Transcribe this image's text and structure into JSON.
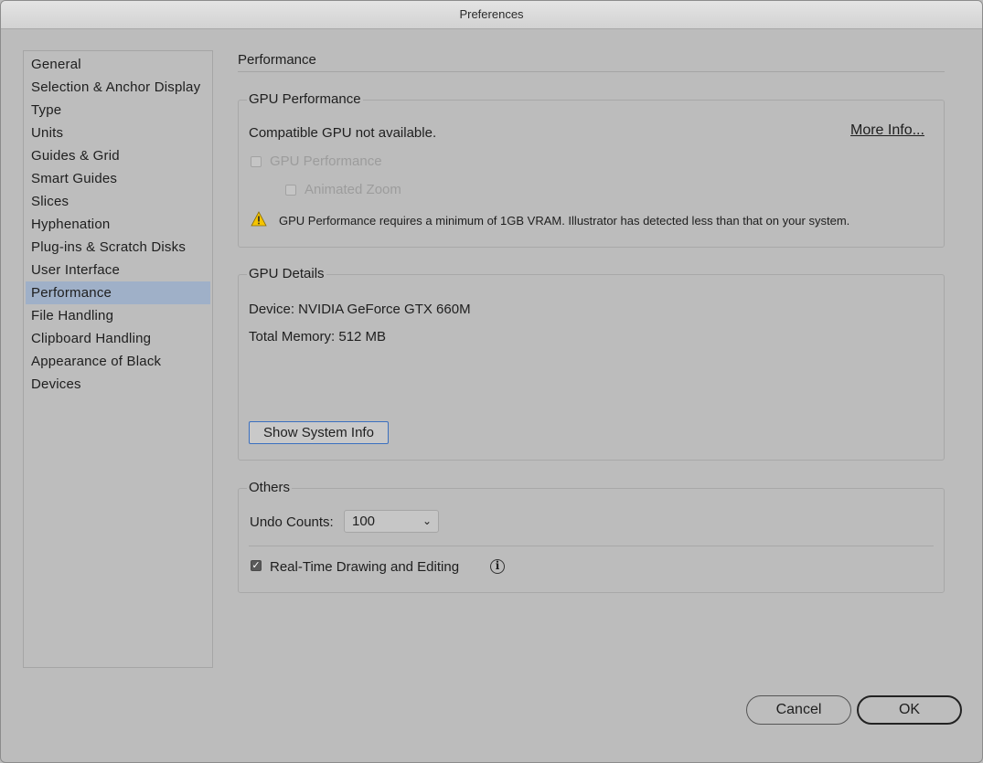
{
  "window": {
    "title": "Preferences"
  },
  "sidebar": {
    "items": [
      {
        "label": "General"
      },
      {
        "label": "Selection & Anchor Display"
      },
      {
        "label": "Type"
      },
      {
        "label": "Units"
      },
      {
        "label": "Guides & Grid"
      },
      {
        "label": "Smart Guides"
      },
      {
        "label": "Slices"
      },
      {
        "label": "Hyphenation"
      },
      {
        "label": "Plug-ins & Scratch Disks"
      },
      {
        "label": "User Interface"
      },
      {
        "label": "Performance"
      },
      {
        "label": "File Handling"
      },
      {
        "label": "Clipboard Handling"
      },
      {
        "label": "Appearance of Black"
      },
      {
        "label": "Devices"
      }
    ],
    "selected": "Performance"
  },
  "main": {
    "section_title": "Performance",
    "gpu_performance": {
      "title": "GPU Performance",
      "status": "Compatible GPU not available.",
      "more_info": "More Info...",
      "gpu_checkbox_label": "GPU Performance",
      "gpu_checked": false,
      "animated_zoom_label": "Animated Zoom",
      "animated_zoom_checked": false,
      "warning_icon": "warning-icon",
      "warning_text": "GPU Performance requires a minimum of 1GB VRAM. Illustrator has detected less than that on your system."
    },
    "gpu_details": {
      "title": "GPU Details",
      "device": "Device: NVIDIA GeForce GTX 660M",
      "memory": "Total Memory: 512 MB",
      "show_system_info": "Show System Info"
    },
    "others": {
      "title": "Others",
      "undo_label": "Undo Counts:",
      "undo_value": "100",
      "realtime_label": "Real-Time Drawing and Editing",
      "realtime_checked": true
    }
  },
  "footer": {
    "cancel": "Cancel",
    "ok": "OK"
  },
  "colors": {
    "selected_item_bg": "#9fb0c8",
    "focus_border": "#3a6fbf",
    "warning_yellow": "#f5c400"
  }
}
